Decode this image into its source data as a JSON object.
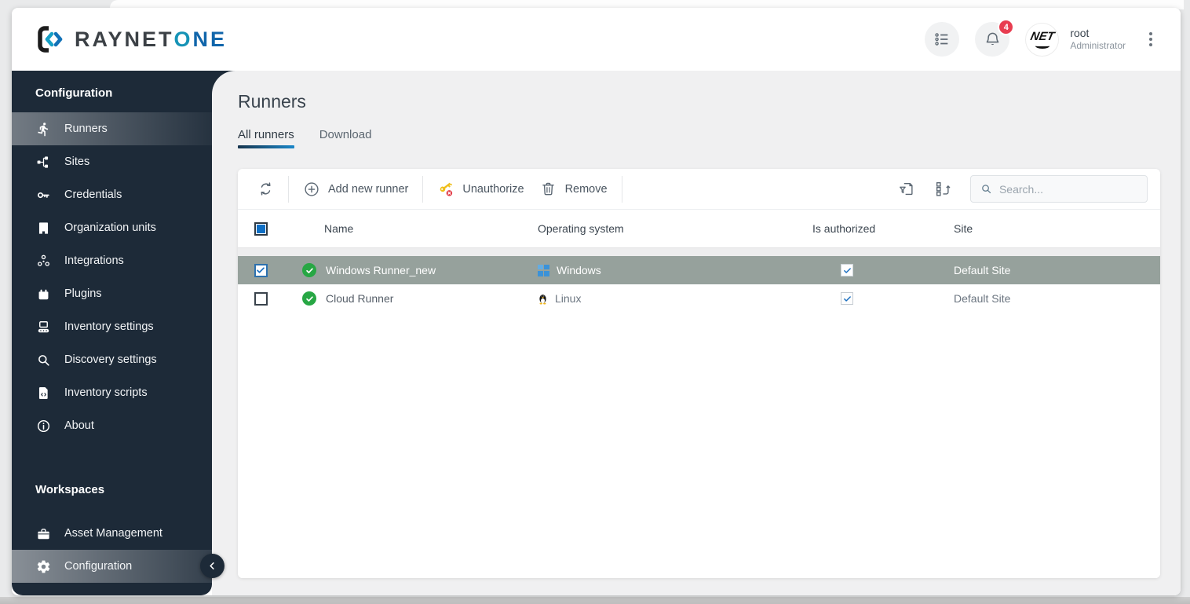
{
  "header": {
    "brand": {
      "primary": "RAYNET",
      "secondary_o": "O",
      "secondary_ne": "NE"
    },
    "notification_badge": "4",
    "user": {
      "name": "root",
      "role": "Administrator",
      "avatar_text": "NET"
    }
  },
  "sidebar": {
    "configuration": {
      "title": "Configuration",
      "items": [
        {
          "label": "Runners",
          "icon": "runner",
          "active": true
        },
        {
          "label": "Sites",
          "icon": "sitemap"
        },
        {
          "label": "Credentials",
          "icon": "key"
        },
        {
          "label": "Organization units",
          "icon": "building"
        },
        {
          "label": "Integrations",
          "icon": "integration"
        },
        {
          "label": "Plugins",
          "icon": "plugin"
        },
        {
          "label": "Inventory settings",
          "icon": "inventory"
        },
        {
          "label": "Discovery settings",
          "icon": "magnifier"
        },
        {
          "label": "Inventory scripts",
          "icon": "file-code"
        },
        {
          "label": "About",
          "icon": "info-circle"
        }
      ]
    },
    "workspaces": {
      "title": "Workspaces",
      "items": [
        {
          "label": "Asset Management",
          "icon": "briefcase"
        },
        {
          "label": "Configuration",
          "icon": "gear",
          "active": true
        }
      ]
    }
  },
  "main": {
    "title": "Runners",
    "tabs": [
      {
        "label": "All runners",
        "active": true
      },
      {
        "label": "Download",
        "active": false
      }
    ],
    "toolbar": {
      "add": "Add new runner",
      "unauthorize": "Unauthorize",
      "remove": "Remove",
      "search_placeholder": "Search..."
    },
    "table": {
      "columns": {
        "name": "Name",
        "os": "Operating system",
        "authorized": "Is authorized",
        "site": "Site"
      },
      "rows": [
        {
          "name": "Windows Runner_new",
          "os": "Windows",
          "site": "Default Site",
          "selected": true,
          "checked": true,
          "authorized": true,
          "status": "ok"
        },
        {
          "name": "Cloud Runner",
          "os": "Linux",
          "site": "Default Site",
          "selected": false,
          "checked": false,
          "authorized": true,
          "status": "ok"
        }
      ]
    }
  },
  "colors": {
    "accent_blue": "#1b87c9",
    "sidebar_bg": "#1d2a38",
    "selected_row_bg": "#96a19c",
    "status_green": "#27a744",
    "badge_red": "#e83d50",
    "key_yellow": "#efbf1b"
  }
}
